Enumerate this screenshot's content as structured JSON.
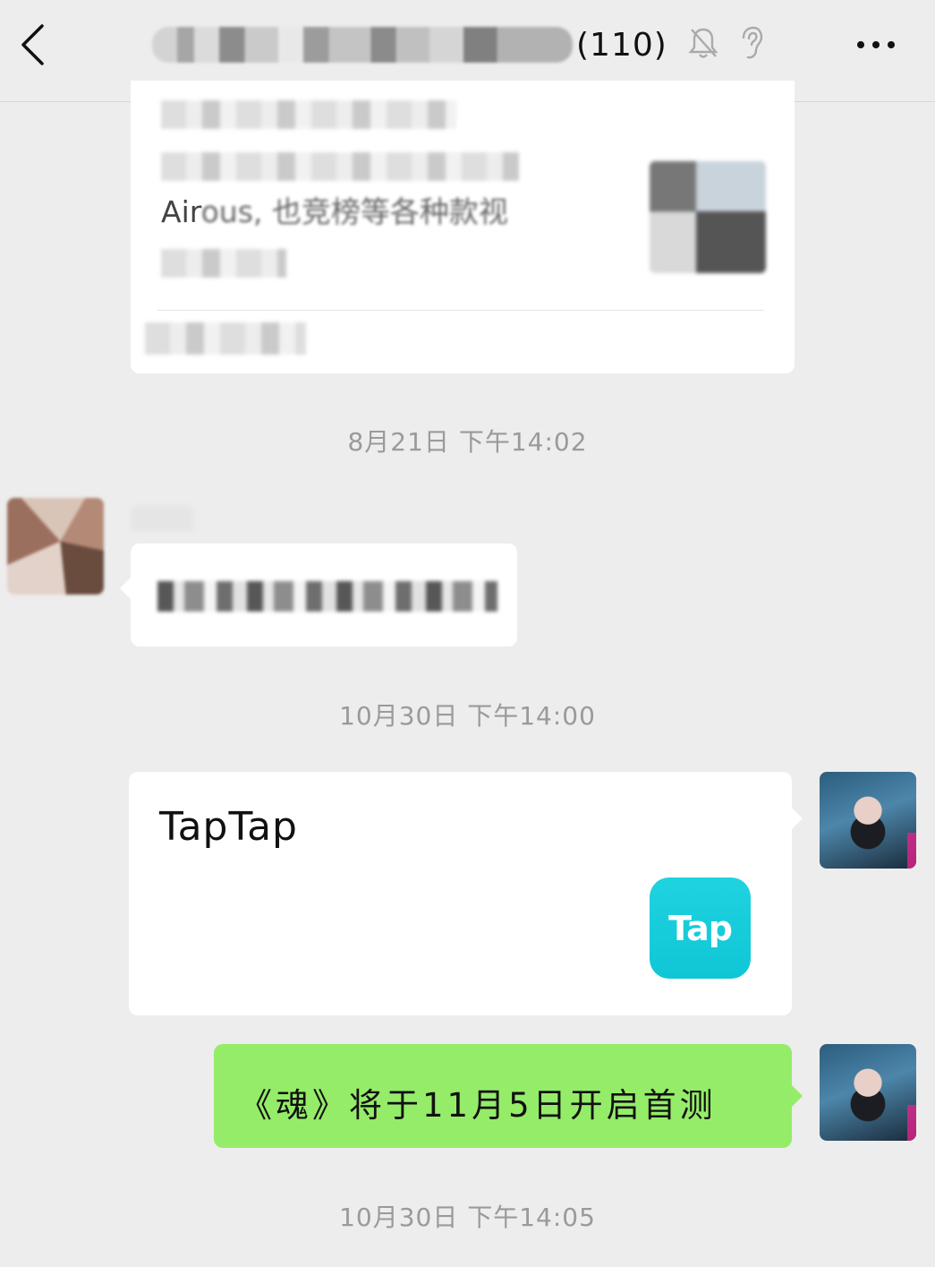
{
  "header": {
    "title_suffix": "(110)",
    "back_icon": "chevron-left-icon",
    "mute_icon": "bell-off-icon",
    "ear_icon": "ear-icon",
    "more_icon": "more-dots-icon"
  },
  "article": {
    "snippet": "Air",
    "snippet_fragment": "ous, 也竞榜等各种款视"
  },
  "timestamps": {
    "t1": "8月21日  下午14:02",
    "t2": "10月30日  下午14:00",
    "t3": "10月30日  下午14:05"
  },
  "link_card": {
    "title": "TapTap",
    "logo_text": "Tap",
    "logo_color": "#15cbd9"
  },
  "outgoing_message": {
    "text": "《魂》将于11月5日开启首测",
    "bubble_color": "#95ec69"
  }
}
